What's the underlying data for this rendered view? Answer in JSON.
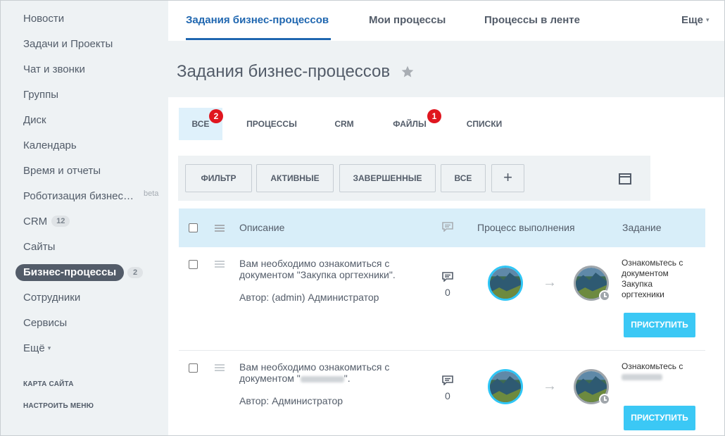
{
  "sidebar": {
    "items": [
      {
        "label": "Новости"
      },
      {
        "label": "Задачи и Проекты"
      },
      {
        "label": "Чат и звонки"
      },
      {
        "label": "Группы"
      },
      {
        "label": "Диск"
      },
      {
        "label": "Календарь"
      },
      {
        "label": "Время и отчеты"
      },
      {
        "label": "Роботизация бизнес…",
        "badge": "beta"
      },
      {
        "label": "CRM",
        "counter": "12"
      },
      {
        "label": "Сайты"
      },
      {
        "label": "Бизнес-процессы",
        "counter": "2"
      },
      {
        "label": "Сотрудники"
      },
      {
        "label": "Сервисы"
      },
      {
        "label": "Ещё",
        "caret": "▾"
      }
    ],
    "site_map": "КАРТА САЙТА",
    "configure_menu": "НАСТРОИТЬ МЕНЮ"
  },
  "topnav": {
    "items": [
      {
        "label": "Задания бизнес-процессов"
      },
      {
        "label": "Мои процессы"
      },
      {
        "label": "Процессы в ленте"
      }
    ],
    "more": "Еще",
    "more_caret": "▾",
    "accent": "#2067b0"
  },
  "page_title": "Задания бизнес-процессов",
  "tabs": [
    {
      "label": "ВСЕ",
      "badge": "2"
    },
    {
      "label": "ПРОЦЕССЫ"
    },
    {
      "label": "CRM"
    },
    {
      "label": "ФАЙЛЫ",
      "badge": "1"
    },
    {
      "label": "СПИСКИ"
    }
  ],
  "filters": {
    "filter": "ФИЛЬТР",
    "active": "АКТИВНЫЕ",
    "completed": "ЗАВЕРШЕННЫЕ",
    "all": "ВСЕ",
    "add": "+"
  },
  "table": {
    "columns": {
      "description": "Описание",
      "progress": "Процесс выполнения",
      "task": "Задание"
    },
    "rows": [
      {
        "desc_line1": "Вам необходимо ознакомиться с",
        "desc_line2": "документом \"Закупка оргтехники\".",
        "author": "Автор: (admin) Администратор",
        "comments": "0",
        "task_lines": [
          "Ознакомьтесь с",
          "документом",
          "Закупка",
          "оргтехники"
        ],
        "button": "ПРИСТУПИТЬ"
      },
      {
        "desc_line1": "Вам необходимо ознакомиться с",
        "desc_line2_prefix": "документом \"",
        "desc_line2_suffix": "\".",
        "author": "Автор: Администратор",
        "comments": "0",
        "task_line1": "Ознакомьтесь с",
        "button": "ПРИСТУПИТЬ"
      }
    ]
  },
  "colors": {
    "badge_red": "#e0161f",
    "button_blue": "#3bc8f5",
    "header_blue": "#d8eef9"
  },
  "icons": [
    "star-icon",
    "comment-icon",
    "drag-handle-icon",
    "window-icon",
    "clock-icon",
    "arrow-right-icon"
  ]
}
